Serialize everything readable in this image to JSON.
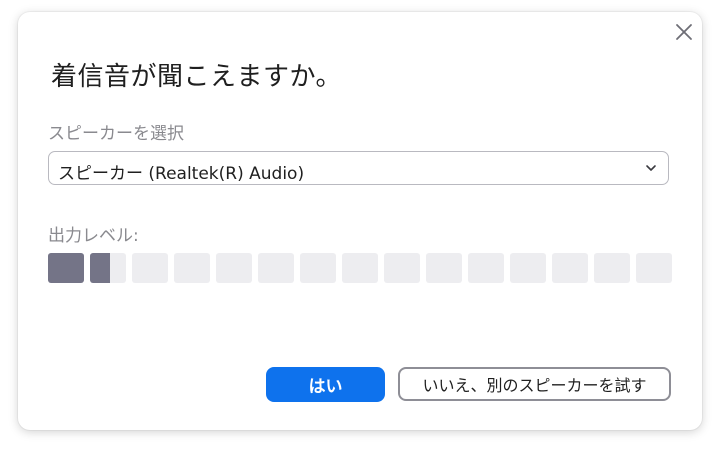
{
  "dialog": {
    "title": "着信音が聞こえますか。",
    "close_icon": "close-icon"
  },
  "speaker": {
    "label": "スピーカーを選択",
    "selected": "スピーカー (Realtek(R) Audio)",
    "chevron_icon": "chevron-down-icon"
  },
  "output_level": {
    "label": "出力レベル:",
    "segments": 15,
    "level_fraction": 0.104,
    "fill_color": "#747487",
    "empty_color": "#ededf0"
  },
  "buttons": {
    "yes_label": "はい",
    "no_label": "いいえ、別のスピーカーを試す",
    "yes_color": "#0e72ed"
  }
}
